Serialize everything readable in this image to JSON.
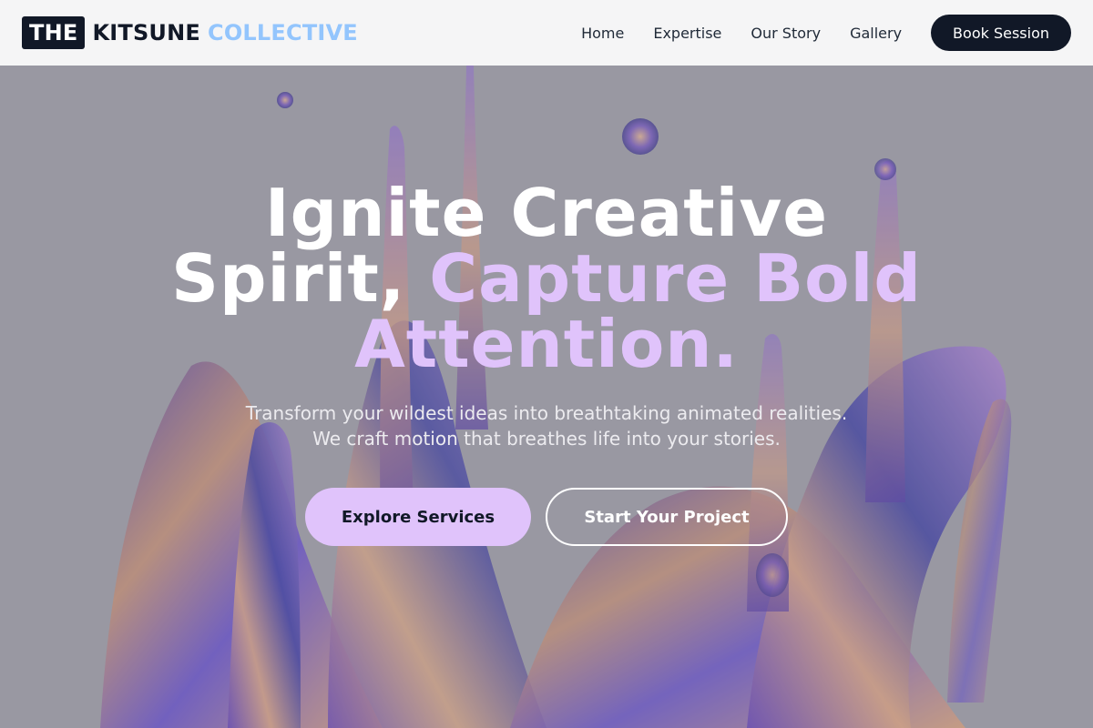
{
  "brand": {
    "box_text": "THE",
    "word1": "KITSUNE",
    "word2": "COLLECTIVE"
  },
  "nav": {
    "links": [
      "Home",
      "Expertise",
      "Our Story",
      "Gallery"
    ],
    "cta_label": "Book Session"
  },
  "hero": {
    "headline_line1": "Ignite Creative",
    "headline_line2_plain": "Spirit, ",
    "headline_line2_accent": "Capture Bold",
    "headline_line3_accent": "Attention.",
    "subtitle_line1": "Transform your wildest ideas into breathtaking animated realities.",
    "subtitle_line2": "We craft motion that breathes life into your stories.",
    "primary_button": "Explore Services",
    "secondary_button": "Start Your Project"
  },
  "colors": {
    "nav_background": "#f5f5f6",
    "brand_dark": "#111827",
    "brand_accent": "#93c5fd",
    "headline_accent": "#e0c3fb",
    "hero_tint": "#93929c"
  },
  "icons": {
    "hero_background": "iridescent-liquid-splash-image"
  }
}
